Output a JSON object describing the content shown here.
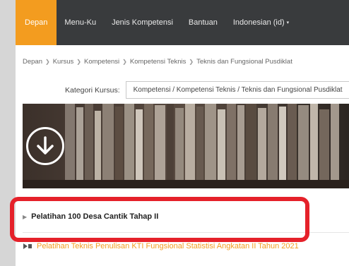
{
  "navbar": {
    "items": [
      {
        "label": "Depan",
        "active": true
      },
      {
        "label": "Menu-Ku"
      },
      {
        "label": "Jenis Kompetensi"
      },
      {
        "label": "Bantuan"
      },
      {
        "label": "Indonesian (id)",
        "caret": "▾"
      }
    ],
    "active_color": "#f39c1f",
    "background_color": "#393b3d"
  },
  "breadcrumb": [
    "Depan",
    "Kursus",
    "Kompetensi",
    "Kompetensi Teknis",
    "Teknis dan Fungsional Pusdiklat"
  ],
  "category": {
    "label": "Kategori Kursus:",
    "selected": "Kompetensi / Kompetensi Teknis / Teknis dan Fungsional Pusdiklat"
  },
  "banner": {
    "image": "bookshelf-banner",
    "scroll_icon": "arrow-down-circle-icon"
  },
  "courses": [
    {
      "title": "Pelatihan 100 Desa Cantik Tahap II",
      "icon": "caret-right-icon",
      "highlighted": true
    },
    {
      "title": "Pelatihan Teknis Penulisan KTI Fungsional Statistisi Angkatan II Tahun 2021",
      "icon": "course-icon"
    }
  ],
  "highlight_color": "#e5212a"
}
